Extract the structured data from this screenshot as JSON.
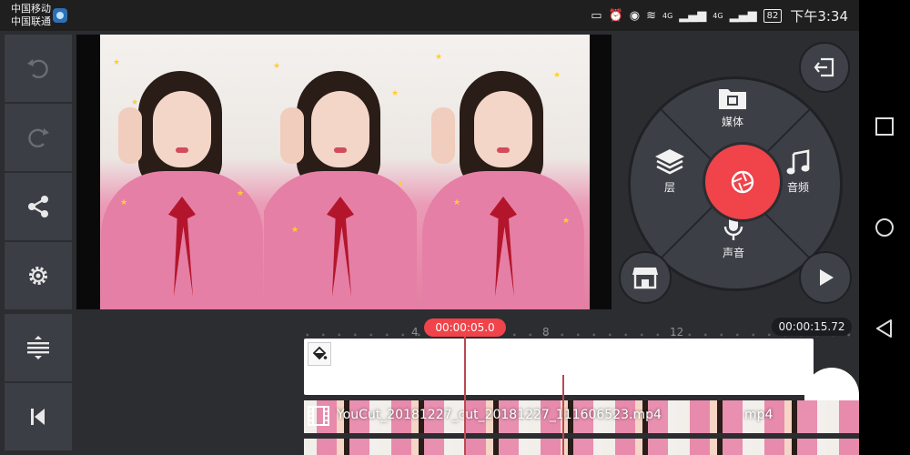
{
  "status_bar": {
    "carrier_1": "中国移动",
    "carrier_2": "中国联通",
    "net_1": "4G",
    "net_2": "4G",
    "battery": "82",
    "time": "下午3:34"
  },
  "toolbar": {
    "undo_icon": "undo-icon",
    "redo_icon": "redo-icon",
    "share_icon": "share-icon",
    "settings_icon": "settings-icon",
    "adjust_icon": "adjust-height-icon",
    "jump_start_icon": "skip-to-start-icon"
  },
  "media_wheel": {
    "media_label": "媒体",
    "layer_label": "层",
    "audio_label": "音频",
    "voice_label": "声音"
  },
  "timeline": {
    "tick_4": "4",
    "tick_8": "8",
    "tick_12": "12",
    "playhead_time": "00:00:05.0",
    "total_time": "00:00:15.72",
    "clip_name": "YouCut_20181227_cut_20181227_111606523.mp4",
    "clip_tail": "mp4"
  },
  "colors": {
    "accent_red": "#f0434a",
    "panel": "#3b3e44",
    "background": "#2b2d31"
  }
}
